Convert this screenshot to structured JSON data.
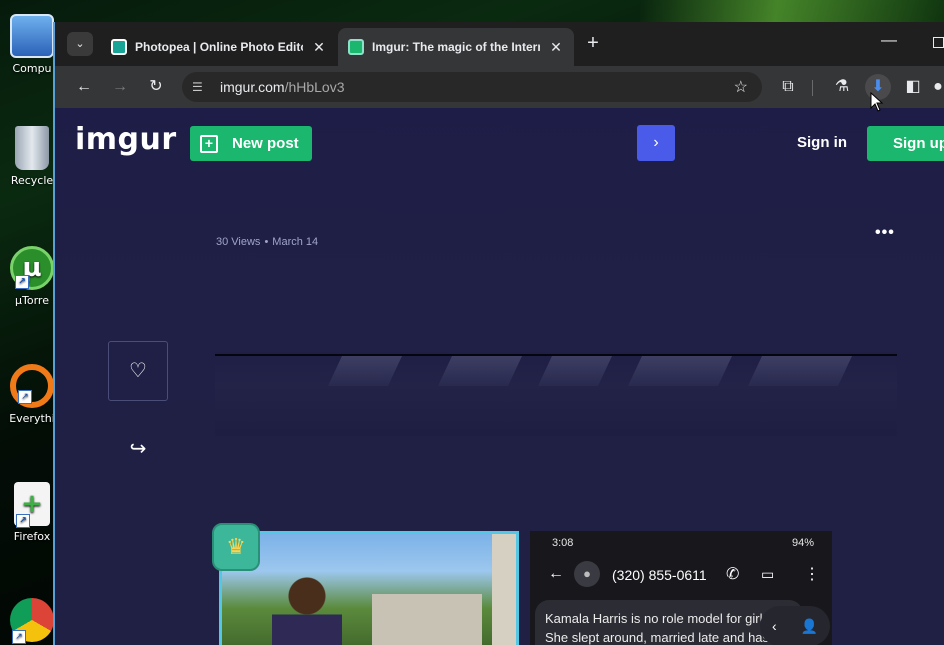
{
  "desktop": {
    "icons": [
      {
        "label": "Compu",
        "icon": "computer-icon"
      },
      {
        "label": "Recycle",
        "icon": "recycle-bin-icon"
      },
      {
        "label": "µTorre",
        "icon": "utorrent-icon"
      },
      {
        "label": "Everythi",
        "icon": "everything-search-icon"
      },
      {
        "label": "Firefox",
        "icon": "document-plus-icon"
      },
      {
        "label": "",
        "icon": "chrome-icon"
      }
    ]
  },
  "browser": {
    "tabs": [
      {
        "title": "Photopea | Online Photo Edito",
        "icon": "photopea-icon",
        "active": false
      },
      {
        "title": "Imgur: The magic of the Intern",
        "icon": "imgur-icon",
        "active": true
      }
    ],
    "tab_close": "✕",
    "new_tab": "+",
    "url_host": "imgur.com",
    "url_path": "/hHbLov3"
  },
  "page": {
    "logo": "imgur",
    "new_post_label": "New post",
    "sign_in_label": "Sign in",
    "sign_up_label": "Sign up",
    "views": "30 Views",
    "date": "March 14",
    "more_label": "•••",
    "phone": {
      "time": "3:08",
      "battery": "94%",
      "number": "(320) 855-0611",
      "message": "Kamala Harris is no role model for girls! She slept around, married late and has never experienced the"
    }
  },
  "colors": {
    "accent_green": "#1bb76e",
    "accent_blue": "#4a5bea",
    "page_bg": "#1f1f46"
  }
}
